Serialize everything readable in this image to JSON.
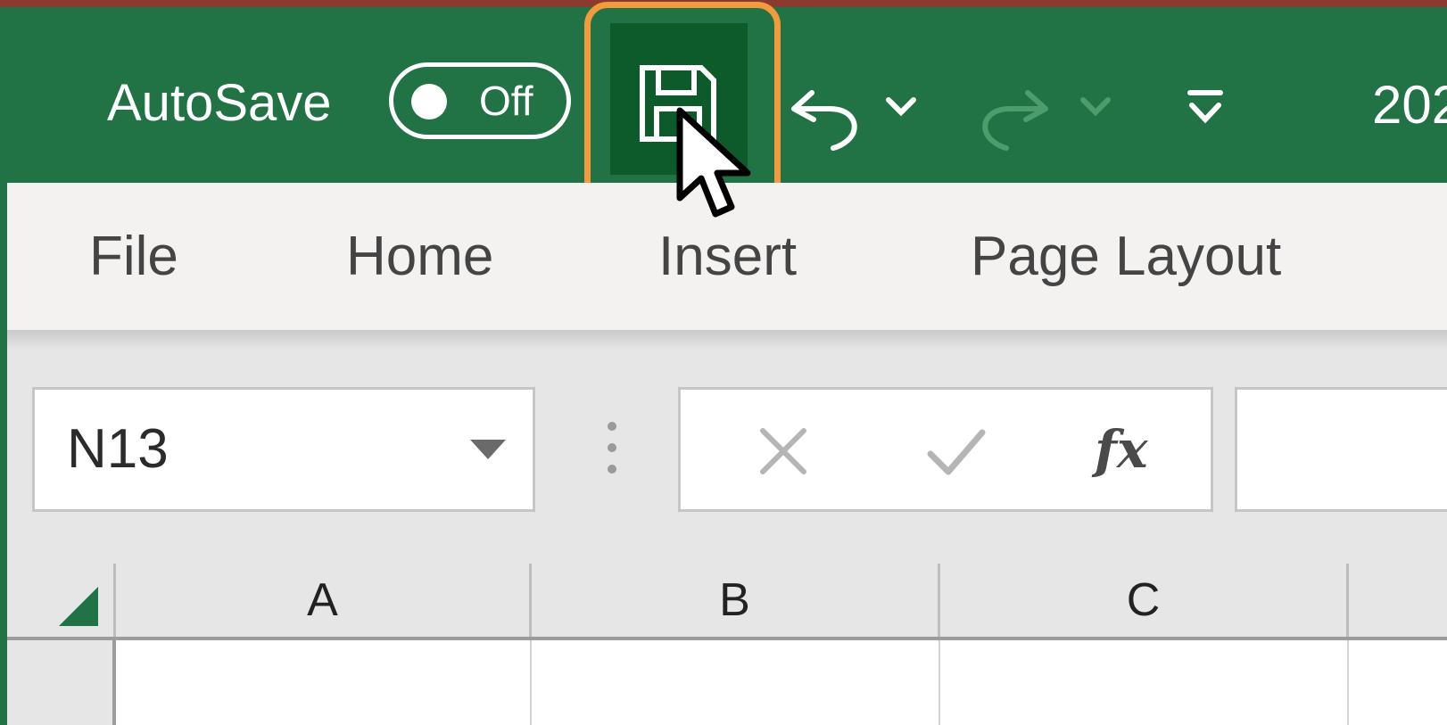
{
  "title_bar": {
    "autosave_label": "AutoSave",
    "autosave_state": "Off",
    "save_tooltip": "Save",
    "undo": "undo-icon",
    "redo": "redo-icon",
    "customize": "customize-qat-icon",
    "file_title_partial": "202",
    "accent_color": "#217346",
    "highlight_color": "#f39a3d"
  },
  "ribbon": {
    "tabs": [
      {
        "label": "File"
      },
      {
        "label": "Home"
      },
      {
        "label": "Insert"
      },
      {
        "label": "Page Layout"
      }
    ]
  },
  "formula_bar": {
    "name_box_value": "N13",
    "cancel_icon": "cancel-x-icon",
    "enter_icon": "enter-check-icon",
    "fx_label": "fx",
    "formula_value": ""
  },
  "grid": {
    "columns": [
      "A",
      "B",
      "C"
    ]
  }
}
